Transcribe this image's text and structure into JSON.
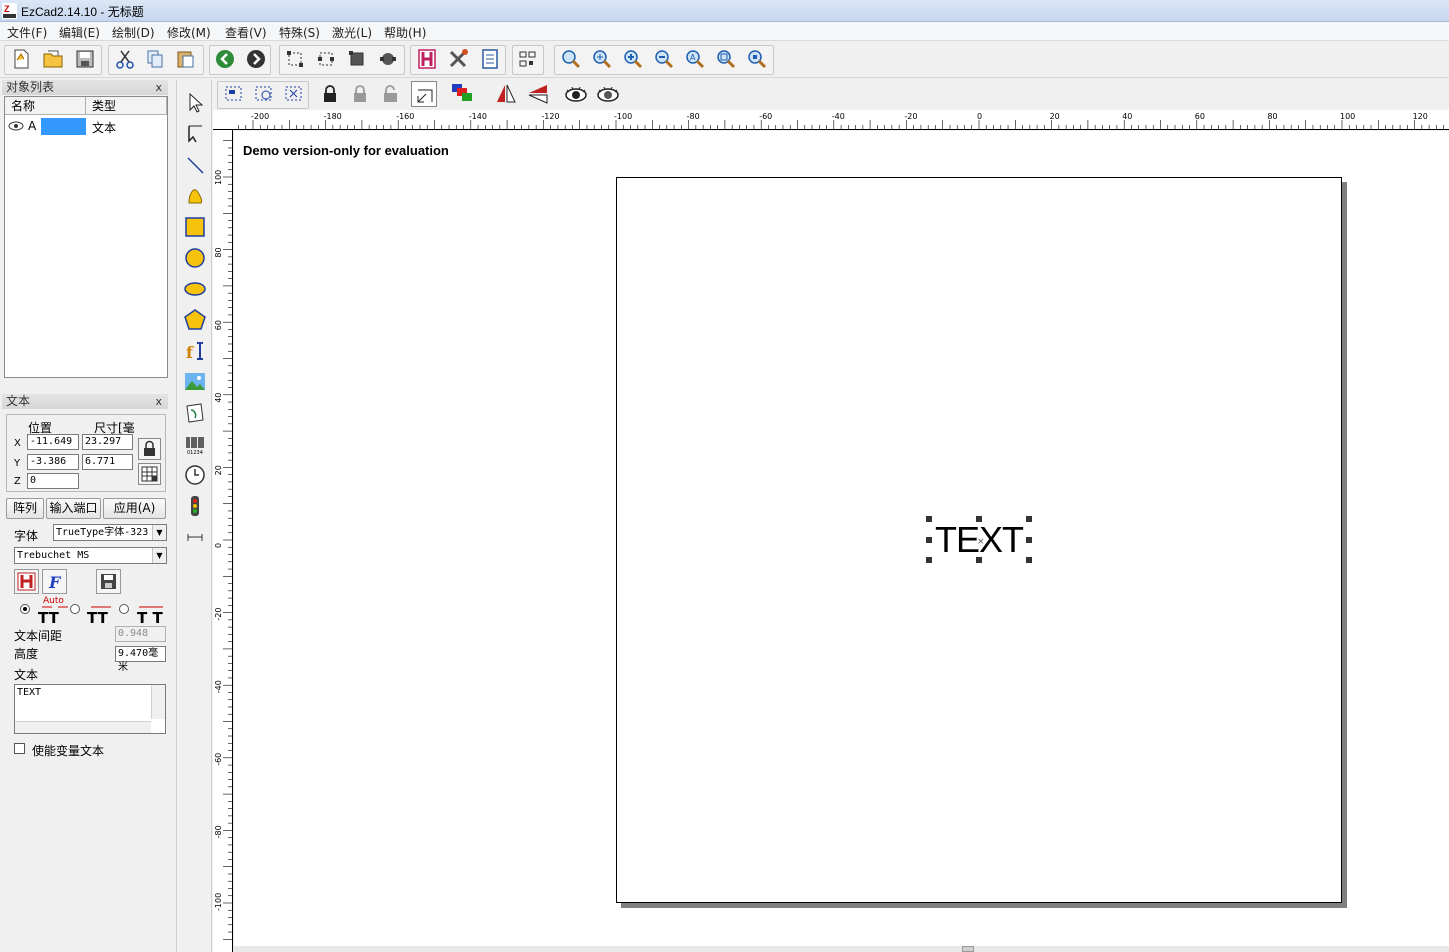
{
  "window": {
    "title": "EzCad2.14.10 - 无标题"
  },
  "menu": [
    "文件(F)",
    "编辑(E)",
    "绘制(D)",
    "修改(M)",
    "查看(V)",
    "特殊(S)",
    "激光(L)",
    "帮助(H)"
  ],
  "object_list": {
    "title": "对象列表",
    "close": "x",
    "headers": {
      "name": "名称",
      "type": "类型"
    },
    "rows": [
      {
        "name": "A",
        "type": "文本"
      }
    ]
  },
  "text_panel": {
    "title": "文本",
    "close": "x",
    "col_position": "位置",
    "col_size": "尺寸[毫",
    "x_label": "X",
    "y_label": "Y",
    "z_label": "Z",
    "x_pos": "-11.649",
    "y_pos": "-3.386",
    "z_pos": "0",
    "x_size": "23.297",
    "y_size": "6.771",
    "btn_array": "阵列",
    "btn_input_port": "输入端口",
    "btn_apply": "应用(A)",
    "font_label": "字体",
    "font_type": "TrueType字体-323",
    "font_name": "Trebuchet MS",
    "spacing_auto_label": "Auto",
    "text_spacing_label": "文本间距",
    "text_spacing_value": "0.948",
    "height_label": "高度",
    "height_value": "9.470毫米",
    "text_label": "文本",
    "text_value": "TEXT",
    "variable_text_label": "使能变量文本"
  },
  "canvas": {
    "demo_note": "Demo version-only for evaluation",
    "object_text": "TEXT",
    "ruler_h": [
      "-200",
      "-180",
      "-160",
      "-140",
      "-120",
      "-100",
      "-80",
      "-60",
      "-40",
      "-20",
      "0",
      "20",
      "40",
      "60",
      "80",
      "100",
      "120"
    ],
    "ruler_v": [
      "100",
      "80",
      "60",
      "40",
      "20",
      "0",
      "-20",
      "-40",
      "-60",
      "-80",
      "-100"
    ]
  },
  "icons": {
    "toolbar": [
      "new-file-icon",
      "open-file-icon",
      "save-icon",
      "cut-icon",
      "copy-icon",
      "paste-icon",
      "back-icon",
      "forward-icon",
      "select-node-icon",
      "node-mode-icon",
      "node-select-icon",
      "node-circle-icon",
      "hatch-icon",
      "tool-properties-icon",
      "parameters-icon",
      "align-icon",
      "zoom-icon",
      "zoom-in-icon",
      "zoom-in-alt-icon",
      "zoom-out-icon",
      "zoom-all-icon",
      "zoom-window-icon",
      "zoom-objects-icon"
    ],
    "toolbar2": [
      "group-icon",
      "ungroup-icon",
      "grid-select-icon",
      "lock-icon",
      "unlock-icon",
      "unlock-all-icon",
      "snap-icon",
      "color-pick-icon",
      "mirror-h-icon",
      "mirror-v-icon",
      "view-icon",
      "view-all-icon"
    ],
    "draw": [
      "pointer-icon",
      "node-edit-icon",
      "line-icon",
      "curve-icon",
      "rectangle-icon",
      "circle-icon",
      "ellipse-icon",
      "polygon-icon",
      "text-icon",
      "bitmap-icon",
      "vector-file-icon",
      "barcode-icon",
      "timer-icon",
      "io-input-icon",
      "dimension-icon"
    ]
  }
}
